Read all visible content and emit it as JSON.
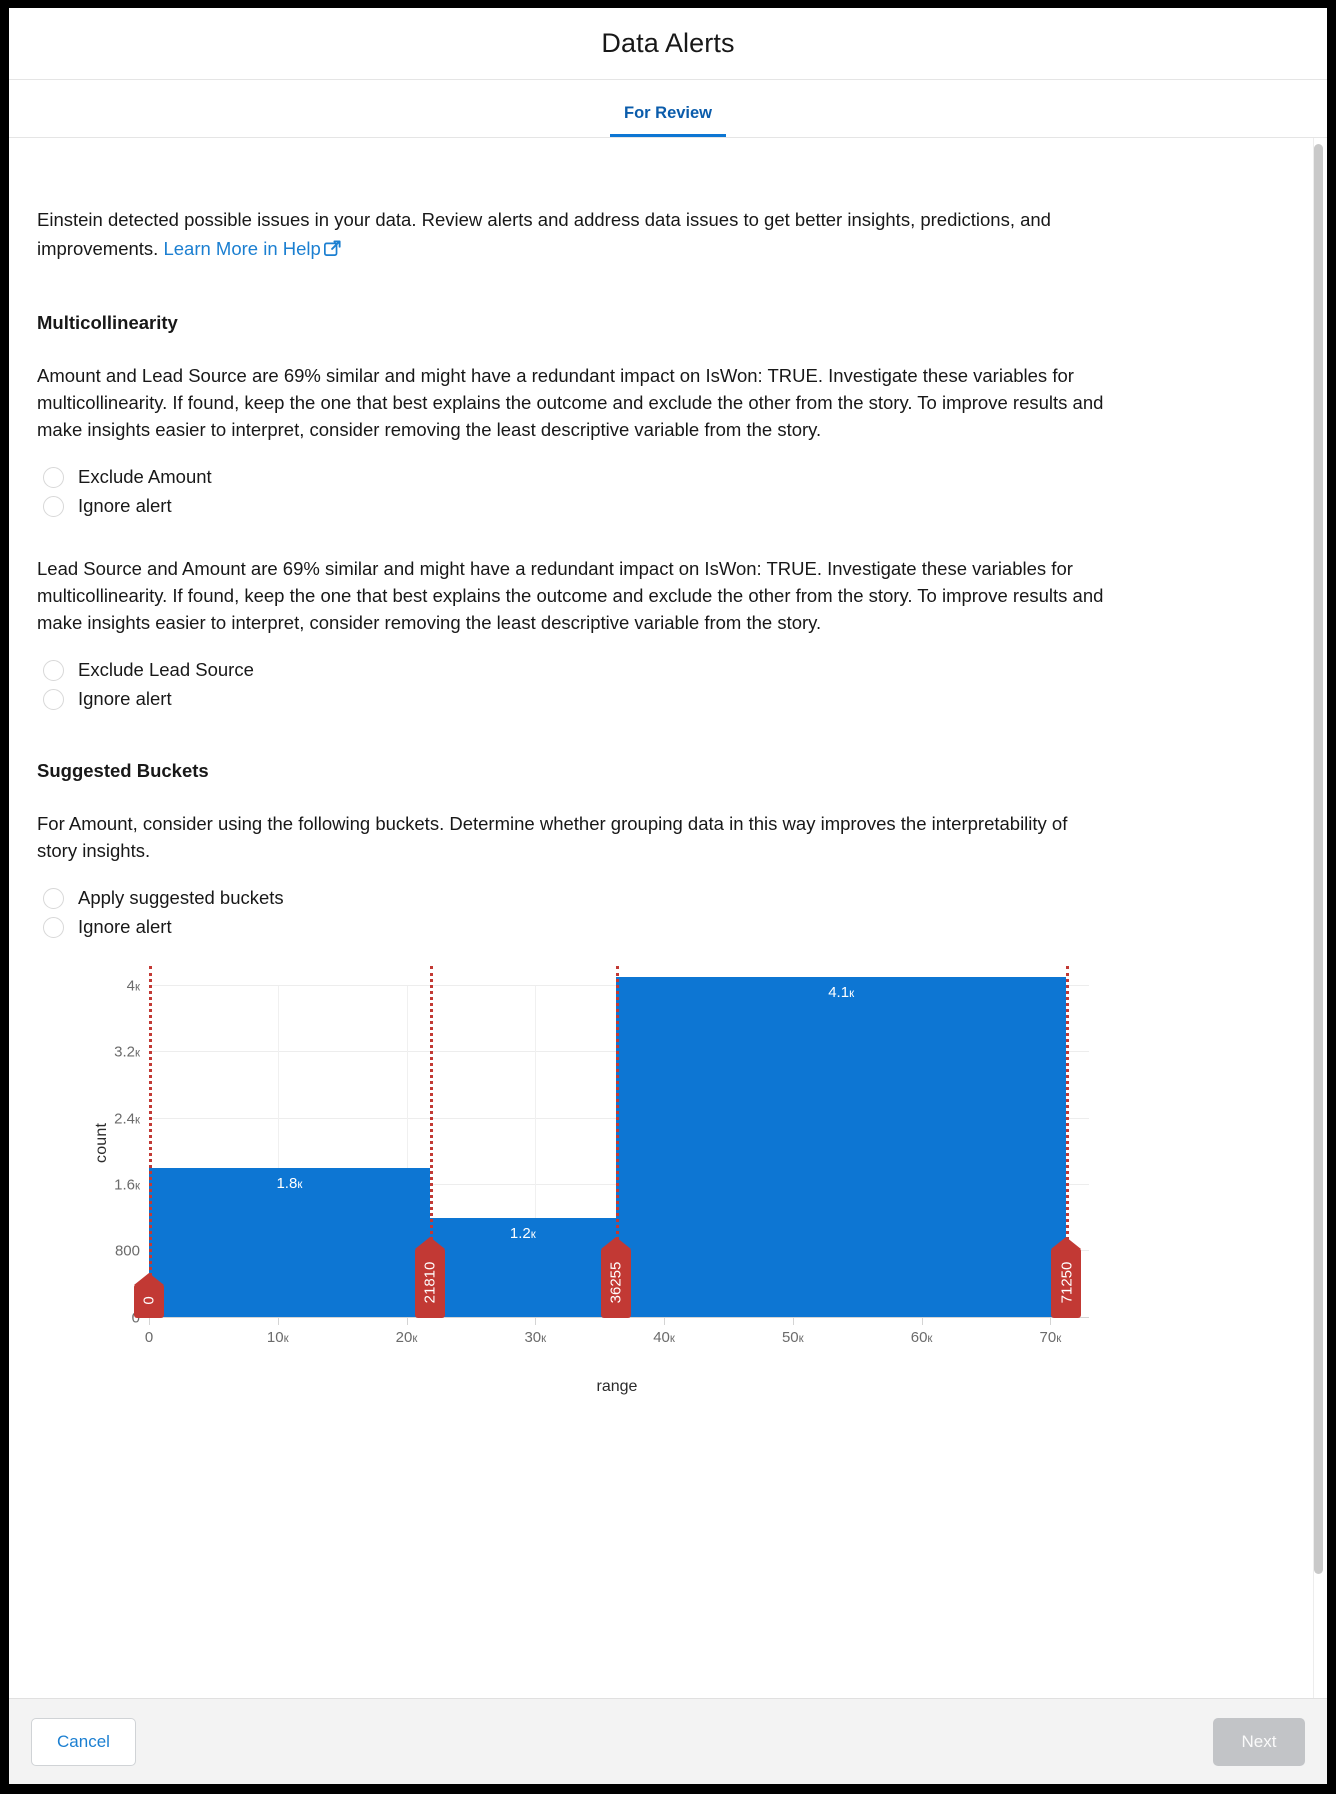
{
  "window": {
    "title": "Data Alerts"
  },
  "tabs": [
    {
      "label": "For Review",
      "selected": true
    }
  ],
  "intro": {
    "text": "Einstein detected possible issues in your data. Review alerts and address data issues to get better insights, predictions, and improvements. ",
    "link_label": "Learn More in Help",
    "link_icon": "external-link-icon"
  },
  "sections": [
    {
      "heading": "Multicollinearity",
      "alerts": [
        {
          "text": "Amount and Lead Source are 69% similar and might have a redundant impact on IsWon: TRUE. Investigate these variables for multicollinearity. If found, keep the one that best explains the outcome and exclude the other from the story. To improve results and make insights easier to interpret, consider removing the least descriptive variable from the story.",
          "options": [
            {
              "label": "Exclude Amount",
              "selected": false
            },
            {
              "label": "Ignore alert",
              "selected": false
            }
          ]
        },
        {
          "text": "Lead Source and Amount are 69% similar and might have a redundant impact on IsWon: TRUE. Investigate these variables for multicollinearity. If found, keep the one that best explains the outcome and exclude the other from the story. To improve results and make insights easier to interpret, consider removing the least descriptive variable from the story.",
          "options": [
            {
              "label": "Exclude Lead Source",
              "selected": false
            },
            {
              "label": "Ignore alert",
              "selected": false
            }
          ]
        }
      ]
    },
    {
      "heading": "Suggested Buckets",
      "alerts": [
        {
          "text": "For Amount, consider using the following buckets. Determine whether grouping data in this way improves the interpretability of story insights.",
          "options": [
            {
              "label": "Apply suggested buckets",
              "selected": false
            },
            {
              "label": "Ignore alert",
              "selected": false
            }
          ]
        }
      ]
    }
  ],
  "chart_data": {
    "type": "bar",
    "title": "",
    "xlabel": "range",
    "ylabel": "count",
    "xlim": [
      0,
      73000
    ],
    "ylim": [
      0,
      4000
    ],
    "grid": true,
    "legend": null,
    "bar_color": "#0d76d3",
    "marker_color": "#c23934",
    "x_ticks": [
      "0",
      "10k",
      "20k",
      "30k",
      "40k",
      "50k",
      "60k",
      "70k"
    ],
    "x_tick_values": [
      0,
      10000,
      20000,
      30000,
      40000,
      50000,
      60000,
      70000
    ],
    "y_ticks": [
      "0",
      "800",
      "1.6k",
      "2.4k",
      "3.2k",
      "4k"
    ],
    "y_tick_values": [
      0,
      800,
      1600,
      2400,
      3200,
      4000
    ],
    "bins": [
      {
        "start": 0,
        "end": 21810,
        "value": 1800,
        "label": "1.8k"
      },
      {
        "start": 21810,
        "end": 36255,
        "value": 1200,
        "label": "1.2k"
      },
      {
        "start": 36255,
        "end": 71250,
        "value": 4100,
        "label": "4.1k"
      }
    ],
    "bucket_markers": [
      {
        "value": 0,
        "label": "0"
      },
      {
        "value": 21810,
        "label": "21810"
      },
      {
        "value": 36255,
        "label": "36255"
      },
      {
        "value": 71250,
        "label": "71250"
      }
    ]
  },
  "footer": {
    "cancel_label": "Cancel",
    "next_label": "Next",
    "next_disabled": true
  }
}
